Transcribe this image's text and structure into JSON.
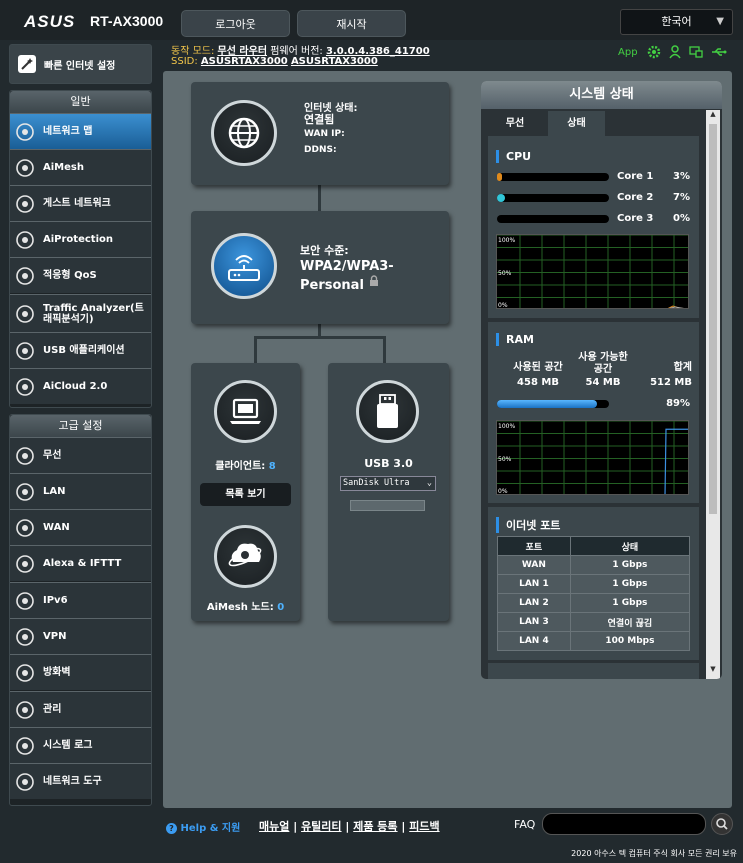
{
  "header": {
    "brand": "ASUS",
    "model": "RT-AX3000",
    "logout": "로그아웃",
    "reboot": "재시작",
    "language": "한국어"
  },
  "infobar": {
    "mode_label": "동작 모드:",
    "mode_value": "무선 라우터",
    "fw_label": "펌웨어 버전:",
    "fw_value": "3.0.0.4.386_41700",
    "ssid_label": "SSID:",
    "ssid1": "ASUSRTAX3000",
    "ssid2": "ASUSRTAX3000",
    "app_label": "App"
  },
  "sidebar": {
    "quick": "빠른 인터넷 설정",
    "general_title": "일반",
    "general": [
      {
        "label": "네트워크 맵",
        "icon": "network-map-icon"
      },
      {
        "label": "AiMesh",
        "icon": "aimesh-icon"
      },
      {
        "label": "게스트 네트워크",
        "icon": "guest-network-icon"
      },
      {
        "label": "AiProtection",
        "icon": "shield-lock-icon"
      },
      {
        "label": "적응형 QoS",
        "icon": "qos-gauge-icon"
      },
      {
        "label": "Traffic Analyzer(트래픽분석기)",
        "icon": "traffic-analyzer-icon"
      },
      {
        "label": "USB 애플리케이션",
        "icon": "usb-icon"
      },
      {
        "label": "AiCloud 2.0",
        "icon": "cloud-icon"
      }
    ],
    "advanced_title": "고급 설정",
    "advanced": [
      {
        "label": "무선",
        "icon": "wireless-icon"
      },
      {
        "label": "LAN",
        "icon": "lan-icon"
      },
      {
        "label": "WAN",
        "icon": "wan-globe-icon"
      },
      {
        "label": "Alexa & IFTTT",
        "icon": "alexa-ifttt-icon"
      },
      {
        "label": "IPv6",
        "icon": "ipv6-icon"
      },
      {
        "label": "VPN",
        "icon": "vpn-icon"
      },
      {
        "label": "방화벽",
        "icon": "firewall-icon"
      },
      {
        "label": "관리",
        "icon": "admin-icon"
      },
      {
        "label": "시스템 로그",
        "icon": "system-log-icon"
      },
      {
        "label": "네트워크 도구",
        "icon": "network-tools-icon"
      }
    ]
  },
  "map": {
    "internet": {
      "status_label": "인터넷 상태:",
      "status_value": "연결됨",
      "wan_ip": "WAN IP:",
      "ddns": "DDNS:"
    },
    "security": {
      "label": "보안 수준:",
      "value": "WPA2/WPA3-Personal"
    },
    "clients": {
      "label": "클라이언트:",
      "count": "8",
      "view_btn": "목록 보기"
    },
    "aimesh": {
      "label": "AiMesh 노드:",
      "count": "0"
    },
    "usb": {
      "label": "USB 3.0",
      "device": "SanDisk Ultra"
    }
  },
  "status": {
    "title": "시스템 상태",
    "tabs": [
      "무선",
      "상태"
    ],
    "cpu": {
      "title": "CPU",
      "cores": [
        {
          "name": "Core 1",
          "pct": "3%",
          "value": 0.03,
          "color": "#e08a1c"
        },
        {
          "name": "Core 2",
          "pct": "7%",
          "value": 0.07,
          "color": "#31c6d8"
        },
        {
          "name": "Core 3",
          "pct": "0%",
          "value": 0,
          "color": "#ffffff"
        }
      ],
      "ticks": [
        "100%",
        "50%",
        "0%"
      ]
    },
    "ram": {
      "title": "RAM",
      "used_label": "사용된 공간",
      "free_label": "사용 가능한 공간",
      "total_label": "합계",
      "used": "458 MB",
      "free": "54 MB",
      "total": "512 MB",
      "pct": "89%",
      "value": 0.89,
      "ticks": [
        "100%",
        "50%",
        "0%"
      ]
    },
    "eth": {
      "title": "이더넷 포트",
      "headers": [
        "포트",
        "상태"
      ],
      "rows": [
        [
          "WAN",
          "1 Gbps"
        ],
        [
          "LAN 1",
          "1 Gbps"
        ],
        [
          "LAN 2",
          "1 Gbps"
        ],
        [
          "LAN 3",
          "연결이 끊김"
        ],
        [
          "LAN 4",
          "100 Mbps"
        ]
      ]
    }
  },
  "footer": {
    "help": "Help & 지원",
    "manual": "매뉴얼",
    "utility": "유틸리티",
    "register": "제품 등록",
    "feedback": "피드백",
    "faq": "FAQ",
    "copyright": "2020 아수스 텍 컴퓨터 주식 회사 모든 권리 보유"
  }
}
